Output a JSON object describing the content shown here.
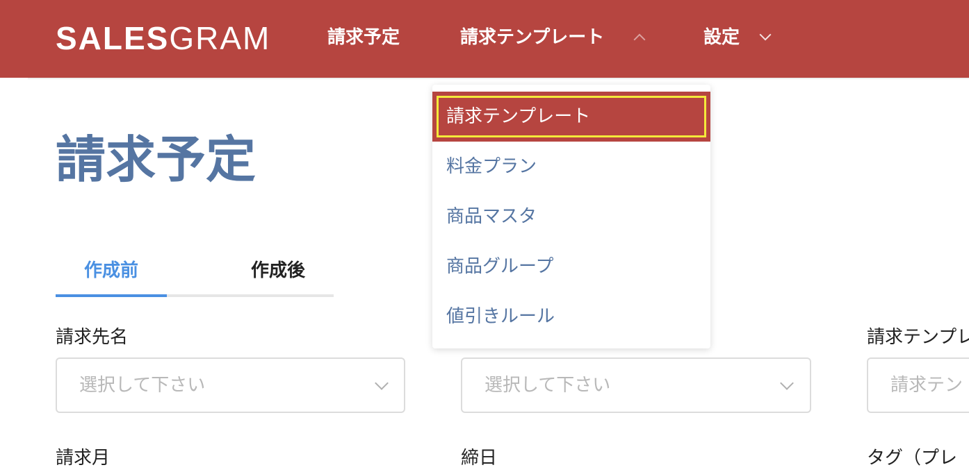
{
  "header": {
    "logo_bold": "SALES",
    "logo_light": "GRAM",
    "nav": {
      "billing_schedule": "請求予定",
      "billing_template": "請求テンプレート",
      "settings": "設定"
    }
  },
  "dropdown": {
    "items": [
      "請求テンプレート",
      "料金プラン",
      "商品マスタ",
      "商品グループ",
      "値引きルール"
    ],
    "selected": "請求テンプレート"
  },
  "page": {
    "title": "請求予定",
    "tabs": [
      "作成前",
      "作成後"
    ],
    "active_tab": "作成前"
  },
  "filters": {
    "customer_label": "請求先名",
    "customer_placeholder": "選択して下さい",
    "middle_placeholder": "選択して下さい",
    "template_label": "請求テンプレ",
    "template_placeholder": "請求テン",
    "month_label": "請求月",
    "closing_label": "締日",
    "tag_label": "タグ（プレ"
  },
  "colors": {
    "brand_red": "#b64540",
    "title_blue": "#5575a2",
    "tab_active_blue": "#4a90e2",
    "highlight_yellow": "#f4ea3a"
  }
}
